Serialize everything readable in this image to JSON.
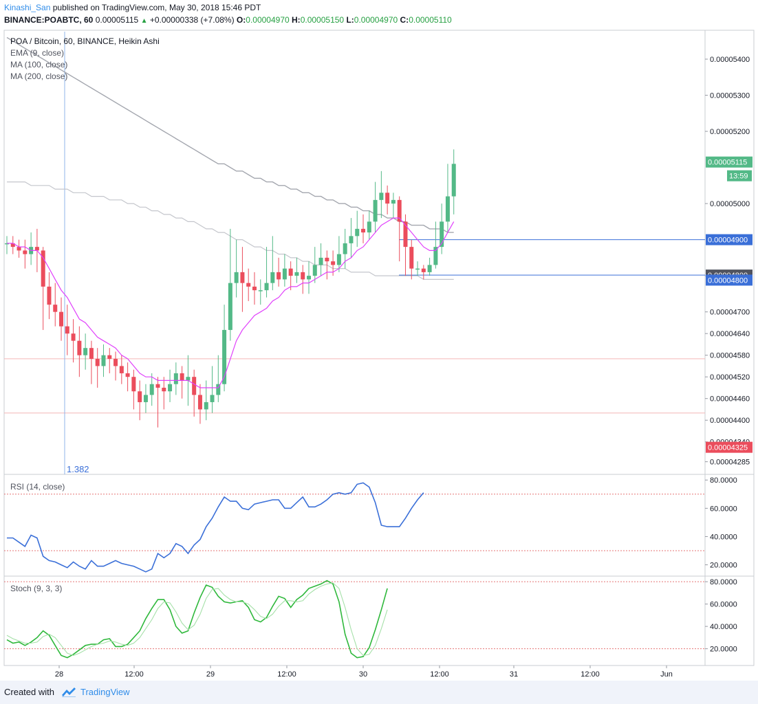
{
  "header": {
    "user": "Kinashi_San",
    "published_text": "published on TradingView.com, May 30, 2018 15:46 PDT",
    "symbol": "BINANCE:POABTC, 60",
    "price": "0.00005115",
    "change": "+0.00000338 (+7.08%)",
    "o_label": "O:",
    "o_value": "0.00004970",
    "h_label": "H:",
    "h_value": "0.00005150",
    "l_label": "L:",
    "l_value": "0.00004970",
    "c_label": "C:",
    "c_value": "0.00005110"
  },
  "legend": {
    "title": "POA / Bitcoin, 60, BINANCE, Heikin Ashi",
    "ema": "EMA (9, close)",
    "ma100": "MA (100, close)",
    "ma200": "MA (200, close)",
    "rsi": "RSI (14, close)",
    "stoch": "Stoch (9, 3, 3)",
    "fib_label": "1.382"
  },
  "footer": {
    "created_with": "Created with",
    "brand": "TradingView"
  },
  "colors": {
    "up": "#53b987",
    "down": "#eb4d5c",
    "ema": "#e040fb",
    "ma": "#b2b5be",
    "rsi": "#3a6fd8",
    "stoch_k": "#2eb83b",
    "stoch_d": "#a5e0a8",
    "hline": "#3a6fd8",
    "band": "#e57373"
  },
  "chart_data": [
    {
      "type": "candlestick",
      "title": "POA / Bitcoin, 60, BINANCE, Heikin Ashi",
      "ylim": [
        4.25e-05,
        5.48e-05
      ],
      "y_ticks": [
        "0.00005400",
        "0.00005300",
        "0.00005200",
        "0.00005000",
        "0.00004800",
        "0.00004700",
        "0.00004640",
        "0.00004580",
        "0.00004520",
        "0.00004460",
        "0.00004400",
        "0.00004340",
        "0.00004285"
      ],
      "x_ticks": [
        "28",
        "12:00",
        "29",
        "12:00",
        "30",
        "12:00",
        "31",
        "12:00",
        "Jun"
      ],
      "price_labels": [
        {
          "label": "0.00005115",
          "value": 5.115e-05,
          "color": "#53b987"
        },
        {
          "label": "13:59",
          "value": 5.077e-05,
          "color": "#53b987"
        },
        {
          "label": "0.00004900",
          "value": 4.9e-05,
          "color": "#3a6fd8"
        },
        {
          "label": "0.00004800",
          "value": 4.802e-05,
          "color": "#50535e"
        },
        {
          "label": "0.00004800",
          "value": 4.788e-05,
          "color": "#3a6fd8"
        },
        {
          "label": "0.00004325",
          "value": 4.325e-05,
          "color": "#eb4d5c"
        }
      ],
      "horizontal_lines": [
        {
          "value": 4.9e-05,
          "color": "#3a6fd8"
        },
        {
          "value": 4.802e-05,
          "color": "#3a6fd8"
        }
      ],
      "band_lines": [
        4.57e-05,
        4.42e-05
      ],
      "candles": [
        [
          4.89e-05,
          4.89e-05,
          4.91e-05,
          4.86e-05
        ],
        [
          4.89e-05,
          4.88e-05,
          4.91e-05,
          4.86e-05
        ],
        [
          4.88e-05,
          4.87e-05,
          4.9e-05,
          4.85e-05
        ],
        [
          4.87e-05,
          4.86e-05,
          4.9e-05,
          4.82e-05
        ],
        [
          4.86e-05,
          4.88e-05,
          4.92e-05,
          4.83e-05
        ],
        [
          4.88e-05,
          4.87e-05,
          4.93e-05,
          4.81e-05
        ],
        [
          4.87e-05,
          4.77e-05,
          4.88e-05,
          4.65e-05
        ],
        [
          4.77e-05,
          4.72e-05,
          4.81e-05,
          4.68e-05
        ],
        [
          4.72e-05,
          4.7e-05,
          4.78e-05,
          4.66e-05
        ],
        [
          4.7e-05,
          4.66e-05,
          4.74e-05,
          4.62e-05
        ],
        [
          4.66e-05,
          4.64e-05,
          4.72e-05,
          4.58e-05
        ],
        [
          4.64e-05,
          4.62e-05,
          4.68e-05,
          4.56e-05
        ],
        [
          4.62e-05,
          4.58e-05,
          4.66e-05,
          4.52e-05
        ],
        [
          4.58e-05,
          4.6e-05,
          4.64e-05,
          4.54e-05
        ],
        [
          4.6e-05,
          4.57e-05,
          4.62e-05,
          4.5e-05
        ],
        [
          4.57e-05,
          4.55e-05,
          4.6e-05,
          4.49e-05
        ],
        [
          4.55e-05,
          4.58e-05,
          4.61e-05,
          4.52e-05
        ],
        [
          4.58e-05,
          4.57e-05,
          4.6e-05,
          4.53e-05
        ],
        [
          4.57e-05,
          4.55e-05,
          4.59e-05,
          4.51e-05
        ],
        [
          4.55e-05,
          4.53e-05,
          4.58e-05,
          4.5e-05
        ],
        [
          4.53e-05,
          4.52e-05,
          4.56e-05,
          4.48e-05
        ],
        [
          4.52e-05,
          4.48e-05,
          4.54e-05,
          4.43e-05
        ],
        [
          4.48e-05,
          4.45e-05,
          4.51e-05,
          4.4e-05
        ],
        [
          4.45e-05,
          4.47e-05,
          4.5e-05,
          4.42e-05
        ],
        [
          4.47e-05,
          4.5e-05,
          4.53e-05,
          4.44e-05
        ],
        [
          4.5e-05,
          4.49e-05,
          4.52e-05,
          4.38e-05
        ],
        [
          4.49e-05,
          4.48e-05,
          4.52e-05,
          4.43e-05
        ],
        [
          4.48e-05,
          4.5e-05,
          4.54e-05,
          4.45e-05
        ],
        [
          4.5e-05,
          4.53e-05,
          4.56e-05,
          4.47e-05
        ],
        [
          4.53e-05,
          4.51e-05,
          4.55e-05,
          4.46e-05
        ],
        [
          4.51e-05,
          4.52e-05,
          4.58e-05,
          4.44e-05
        ],
        [
          4.52e-05,
          4.47e-05,
          4.54e-05,
          4.41e-05
        ],
        [
          4.47e-05,
          4.43e-05,
          4.5e-05,
          4.39e-05
        ],
        [
          4.43e-05,
          4.45e-05,
          4.51e-05,
          4.4e-05
        ],
        [
          4.45e-05,
          4.47e-05,
          4.55e-05,
          4.42e-05
        ],
        [
          4.47e-05,
          4.5e-05,
          4.58e-05,
          4.45e-05
        ],
        [
          4.5e-05,
          4.65e-05,
          4.72e-05,
          4.48e-05
        ],
        [
          4.65e-05,
          4.78e-05,
          4.93e-05,
          4.62e-05
        ],
        [
          4.78e-05,
          4.81e-05,
          4.9e-05,
          4.74e-05
        ],
        [
          4.81e-05,
          4.78e-05,
          4.88e-05,
          4.7e-05
        ],
        [
          4.78e-05,
          4.77e-05,
          4.82e-05,
          4.73e-05
        ],
        [
          4.77e-05,
          4.76e-05,
          4.81e-05,
          4.72e-05
        ],
        [
          4.76e-05,
          4.76e-05,
          4.79e-05,
          4.72e-05
        ],
        [
          4.76e-05,
          4.78e-05,
          4.88e-05,
          4.74e-05
        ],
        [
          4.78e-05,
          4.81e-05,
          4.91e-05,
          4.76e-05
        ],
        [
          4.81e-05,
          4.79e-05,
          4.85e-05,
          4.77e-05
        ],
        [
          4.79e-05,
          4.82e-05,
          4.86e-05,
          4.77e-05
        ],
        [
          4.82e-05,
          4.8e-05,
          4.84e-05,
          4.76e-05
        ],
        [
          4.8e-05,
          4.81e-05,
          4.85e-05,
          4.78e-05
        ],
        [
          4.81e-05,
          4.79e-05,
          4.83e-05,
          4.75e-05
        ],
        [
          4.79e-05,
          4.8e-05,
          4.84e-05,
          4.75e-05
        ],
        [
          4.8e-05,
          4.83e-05,
          4.88e-05,
          4.78e-05
        ],
        [
          4.83e-05,
          4.85e-05,
          4.89e-05,
          4.8e-05
        ],
        [
          4.85e-05,
          4.84e-05,
          4.87e-05,
          4.79e-05
        ],
        [
          4.84e-05,
          4.83e-05,
          4.87e-05,
          4.8e-05
        ],
        [
          4.83e-05,
          4.86e-05,
          4.91e-05,
          4.81e-05
        ],
        [
          4.86e-05,
          4.89e-05,
          4.93e-05,
          4.82e-05
        ],
        [
          4.89e-05,
          4.91e-05,
          4.96e-05,
          4.85e-05
        ],
        [
          4.91e-05,
          4.93e-05,
          4.98e-05,
          4.88e-05
        ],
        [
          4.93e-05,
          4.92e-05,
          4.97e-05,
          4.89e-05
        ],
        [
          4.92e-05,
          4.95e-05,
          4.98e-05,
          4.9e-05
        ],
        [
          4.95e-05,
          5.01e-05,
          5.06e-05,
          4.92e-05
        ],
        [
          5.01e-05,
          5.03e-05,
          5.09e-05,
          4.96e-05
        ],
        [
          5.03e-05,
          5e-05,
          5.05e-05,
          4.97e-05
        ],
        [
          5e-05,
          5.01e-05,
          5.03e-05,
          4.96e-05
        ],
        [
          5.01e-05,
          4.95e-05,
          5.02e-05,
          4.84e-05
        ],
        [
          4.95e-05,
          4.88e-05,
          4.97e-05,
          4.8e-05
        ],
        [
          4.88e-05,
          4.82e-05,
          4.9e-05,
          4.79e-05
        ],
        [
          4.82e-05,
          4.82e-05,
          4.84e-05,
          4.8e-05
        ],
        [
          4.82e-05,
          4.81e-05,
          4.83e-05,
          4.79e-05
        ],
        [
          4.81e-05,
          4.83e-05,
          4.85e-05,
          4.8e-05
        ],
        [
          4.83e-05,
          4.88e-05,
          4.95e-05,
          4.82e-05
        ],
        [
          4.88e-05,
          4.95e-05,
          5e-05,
          4.86e-05
        ],
        [
          4.95e-05,
          5.02e-05,
          5.11e-05,
          4.92e-05
        ],
        [
          5.02e-05,
          5.11e-05,
          5.15e-05,
          4.97e-05
        ]
      ],
      "ema_9": [
        4.89e-05,
        4.89e-05,
        4.88e-05,
        4.88e-05,
        4.87e-05,
        4.87e-05,
        4.85e-05,
        4.82e-05,
        4.79e-05,
        4.76e-05,
        4.74e-05,
        4.71e-05,
        4.68e-05,
        4.67e-05,
        4.65e-05,
        4.63e-05,
        4.62e-05,
        4.61e-05,
        4.6e-05,
        4.58e-05,
        4.57e-05,
        4.55e-05,
        4.53e-05,
        4.52e-05,
        4.52e-05,
        4.51e-05,
        4.51e-05,
        4.51e-05,
        4.51e-05,
        4.51e-05,
        4.51e-05,
        4.5e-05,
        4.49e-05,
        4.49e-05,
        4.49e-05,
        4.49e-05,
        4.52e-05,
        4.57e-05,
        4.62e-05,
        4.65e-05,
        4.67e-05,
        4.69e-05,
        4.7e-05,
        4.71e-05,
        4.73e-05,
        4.74e-05,
        4.76e-05,
        4.77e-05,
        4.77e-05,
        4.78e-05,
        4.78e-05,
        4.79e-05,
        4.8e-05,
        4.81e-05,
        4.81e-05,
        4.82e-05,
        4.84e-05,
        4.85e-05,
        4.87e-05,
        4.88e-05,
        4.9e-05,
        4.92e-05,
        4.94e-05,
        4.95e-05,
        4.96e-05,
        4.96e-05,
        4.94e-05,
        4.92e-05,
        4.9e-05,
        4.88e-05,
        4.87e-05,
        4.87e-05,
        4.89e-05,
        4.92e-05,
        4.95e-05
      ],
      "ma_100": [
        5.46e-05,
        5.45e-05,
        5.44e-05,
        5.43e-05,
        5.42e-05,
        5.41e-05,
        5.4e-05,
        5.39e-05,
        5.38e-05,
        5.37e-05,
        5.36e-05,
        5.35e-05,
        5.34e-05,
        5.33e-05,
        5.32e-05,
        5.31e-05,
        5.3e-05,
        5.29e-05,
        5.28e-05,
        5.27e-05,
        5.26e-05,
        5.25e-05,
        5.24e-05,
        5.23e-05,
        5.22e-05,
        5.21e-05,
        5.2e-05,
        5.19e-05,
        5.18e-05,
        5.17e-05,
        5.16e-05,
        5.15e-05,
        5.14e-05,
        5.13e-05,
        5.12e-05,
        5.11e-05,
        5.11e-05,
        5.1e-05,
        5.09e-05,
        5.09e-05,
        5.08e-05,
        5.07e-05,
        5.07e-05,
        5.06e-05,
        5.06e-05,
        5.05e-05,
        5.05e-05,
        5.04e-05,
        5.04e-05,
        5.03e-05,
        5.03e-05,
        5.02e-05,
        5.02e-05,
        5.01e-05,
        5.01e-05,
        5e-05,
        5e-05,
        4.99e-05,
        4.99e-05,
        4.98e-05,
        4.98e-05,
        4.97e-05,
        4.97e-05,
        4.96e-05,
        4.96e-05,
        4.95e-05,
        4.95e-05,
        4.94e-05,
        4.94e-05,
        4.94e-05,
        4.93e-05,
        4.93e-05,
        4.93e-05,
        4.92e-05,
        4.92e-05
      ],
      "ma_200": [
        5.06e-05,
        5.06e-05,
        5.06e-05,
        5.06e-05,
        5.05e-05,
        5.05e-05,
        5.05e-05,
        5.05e-05,
        5.04e-05,
        5.04e-05,
        5.04e-05,
        5.03e-05,
        5.03e-05,
        5.03e-05,
        5.02e-05,
        5.02e-05,
        5.02e-05,
        5.01e-05,
        5.01e-05,
        5.01e-05,
        5e-05,
        5e-05,
        4.99e-05,
        4.99e-05,
        4.98e-05,
        4.98e-05,
        4.97e-05,
        4.97e-05,
        4.96e-05,
        4.96e-05,
        4.95e-05,
        4.95e-05,
        4.94e-05,
        4.93e-05,
        4.93e-05,
        4.92e-05,
        4.92e-05,
        4.91e-05,
        4.9e-05,
        4.9e-05,
        4.89e-05,
        4.88e-05,
        4.88e-05,
        4.87e-05,
        4.87e-05,
        4.86e-05,
        4.86e-05,
        4.85e-05,
        4.85e-05,
        4.84e-05,
        4.84e-05,
        4.83e-05,
        4.83e-05,
        4.83e-05,
        4.82e-05,
        4.82e-05,
        4.82e-05,
        4.81e-05,
        4.81e-05,
        4.81e-05,
        4.81e-05,
        4.8e-05,
        4.8e-05,
        4.8e-05,
        4.8e-05,
        4.8e-05,
        4.8e-05,
        4.8e-05,
        4.8e-05,
        4.79e-05,
        4.79e-05,
        4.79e-05,
        4.79e-05,
        4.79e-05,
        4.79e-05
      ]
    },
    {
      "type": "line",
      "title": "RSI (14, close)",
      "ylim": [
        12,
        84
      ],
      "y_ticks": [
        "80.0000",
        "60.0000",
        "40.0000",
        "20.0000"
      ],
      "bands": [
        30,
        70
      ],
      "series": [
        {
          "name": "RSI (14, close)",
          "values": [
            39,
            39,
            36,
            33,
            41,
            39,
            26,
            23,
            22,
            20,
            18,
            22,
            19,
            17,
            23,
            19,
            19,
            21,
            23,
            21,
            20,
            19,
            17,
            15,
            17,
            28,
            25,
            28,
            35,
            33,
            28,
            34,
            38,
            47,
            53,
            61,
            68,
            65,
            65,
            60,
            59,
            63,
            64,
            65,
            66,
            66,
            60,
            60,
            64,
            68,
            61,
            61,
            63,
            66,
            70,
            71,
            70,
            71,
            77,
            78,
            75,
            64,
            48,
            47,
            47,
            47,
            53,
            60,
            66,
            71
          ]
        }
      ]
    },
    {
      "type": "line",
      "title": "Stoch (9, 3, 3)",
      "ylim": [
        5,
        85
      ],
      "y_ticks": [
        "80.0000",
        "60.0000",
        "40.0000",
        "20.0000"
      ],
      "bands": [
        20,
        80
      ],
      "series": [
        {
          "name": "%K",
          "values": [
            28,
            25,
            26,
            23,
            26,
            30,
            36,
            32,
            23,
            14,
            12,
            15,
            19,
            23,
            24,
            24,
            28,
            29,
            22,
            22,
            24,
            30,
            36,
            47,
            56,
            64,
            64,
            55,
            40,
            34,
            36,
            52,
            66,
            77,
            75,
            67,
            62,
            61,
            62,
            63,
            57,
            46,
            44,
            48,
            58,
            67,
            65,
            57,
            64,
            68,
            74,
            76,
            78,
            81,
            78,
            62,
            33,
            16,
            12,
            13,
            21,
            37,
            55,
            74
          ]
        },
        {
          "name": "%D",
          "values": [
            32,
            29,
            27,
            25,
            25,
            26,
            31,
            33,
            30,
            23,
            16,
            14,
            16,
            19,
            22,
            24,
            25,
            27,
            26,
            24,
            23,
            25,
            30,
            38,
            46,
            56,
            62,
            61,
            53,
            43,
            37,
            41,
            51,
            65,
            73,
            74,
            68,
            64,
            62,
            62,
            60,
            55,
            49,
            47,
            51,
            58,
            63,
            63,
            62,
            63,
            69,
            73,
            76,
            78,
            79,
            74,
            57,
            37,
            20,
            14,
            15,
            23,
            38,
            55
          ]
        }
      ]
    }
  ]
}
